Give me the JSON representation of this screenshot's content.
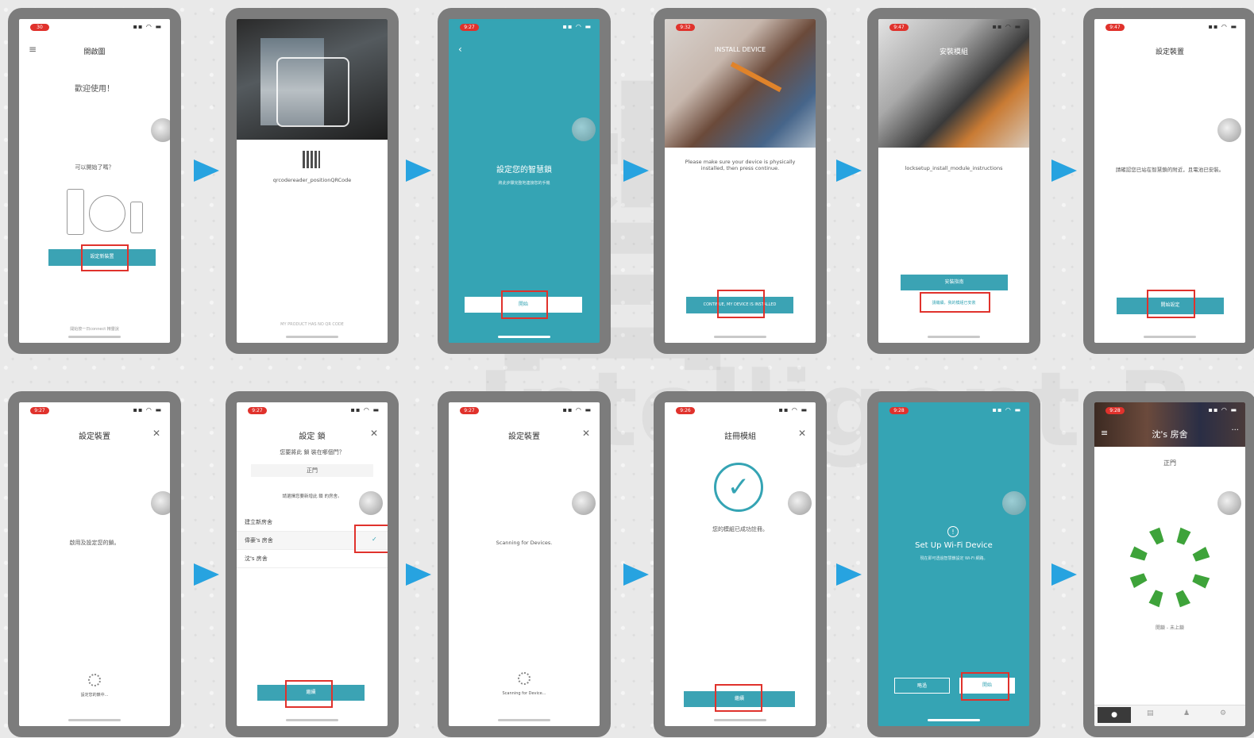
{
  "watermark": {
    "big": "智",
    "bottom": "Intelligent B"
  },
  "colors": {
    "teal": "#35a4b4",
    "highlight": "#e0322c",
    "arrow": "#27a3e0",
    "phone_frame": "#7c7c7c"
  },
  "screens": {
    "s1": {
      "title": "開啟圖",
      "welcome": "歡迎使用！",
      "question": "可以開始了嗎？",
      "button": "設定新裝置",
      "footer": "開始按一日connect 精靈說"
    },
    "s2": {
      "qr_label": "qrcodereader_positionQRCode",
      "footer": "MY PRODUCT HAS NO QR CODE"
    },
    "s3": {
      "heading": "設定您的智慧鎖",
      "sub": "將此步驟完整地連接您的手機",
      "button": "開始"
    },
    "s4": {
      "title": "INSTALL DEVICE",
      "text": "Please make sure your device is physically installed, then press continue.",
      "button": "CONTINUE, MY DEVICE IS INSTALLED"
    },
    "s5": {
      "title": "安裝模組",
      "text": "locksetup_install_module_instructions",
      "button": "安裝指南",
      "link": "請繼續，我的模組已安裝"
    },
    "s6": {
      "title": "設定裝置",
      "text": "請確認您已站在智慧鎖的附近，且電池已安裝。",
      "button": "開始設定"
    },
    "s7": {
      "title": "設定裝置",
      "text": "啟用及設定您的鎖。",
      "status": "設定您的鎖中..."
    },
    "s8": {
      "title": "設定 鎖",
      "question": "您要將此 鎖 裝在哪個門？",
      "door": "正門",
      "prompt": "請選擇您要新增此 鎖 的房舍。",
      "houses": [
        "建立新房舍",
        "偉豪's 房舍",
        "沈's 房舍"
      ],
      "button": "繼續"
    },
    "s9": {
      "title": "設定裝置",
      "text": "Scanning for Devices.",
      "status": "Scanning for Device..."
    },
    "s10": {
      "title": "註冊模組",
      "text": "您的模組已成功註冊。",
      "button": "繼續"
    },
    "s11": {
      "heading": "Set Up Wi-Fi Device",
      "sub": "現在即可透過智慧鎖設定 Wi-Fi 網路。",
      "skip": "略過",
      "start": "開始"
    },
    "s12": {
      "house": "沈's 房舍",
      "door": "正門",
      "status": "開鎖 - 未上鎖"
    }
  }
}
